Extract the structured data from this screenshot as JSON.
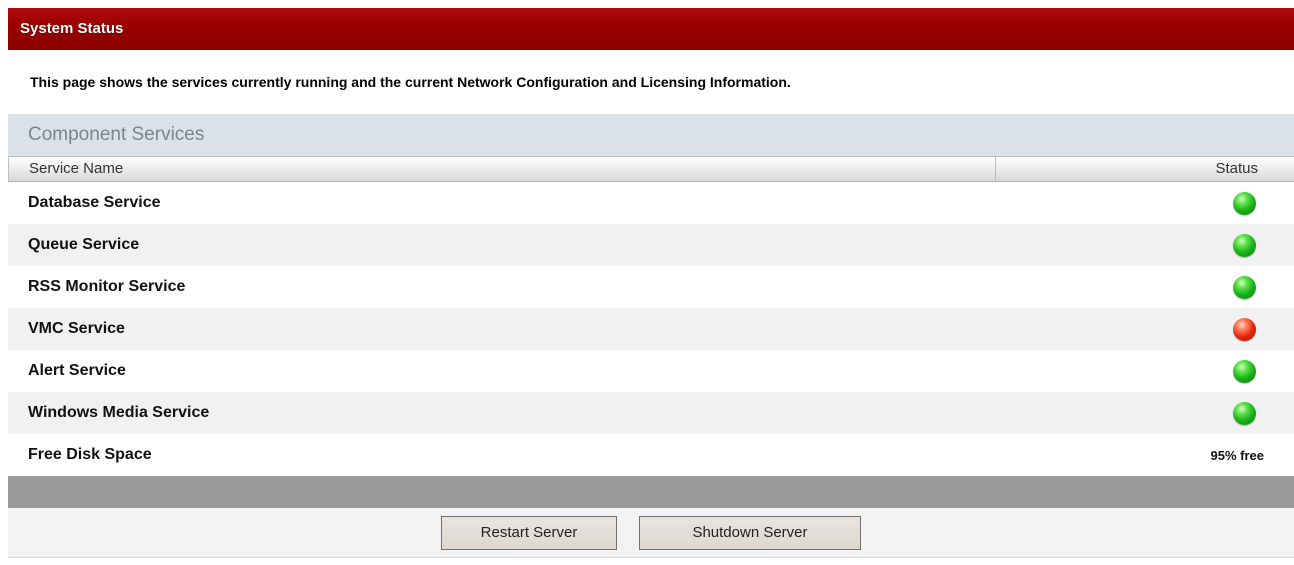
{
  "window": {
    "title": "System Status"
  },
  "description": "This page shows the services currently running and the current Network Configuration and Licensing Information.",
  "section": {
    "title": "Component Services"
  },
  "table": {
    "columns": {
      "name": "Service Name",
      "status": "Status"
    },
    "rows": [
      {
        "name": "Database Service",
        "status": "running",
        "status_icon": "green-status-icon"
      },
      {
        "name": "Queue Service",
        "status": "running",
        "status_icon": "green-status-icon"
      },
      {
        "name": "RSS Monitor Service",
        "status": "running",
        "status_icon": "green-status-icon"
      },
      {
        "name": "VMC Service",
        "status": "stopped",
        "status_icon": "red-status-icon"
      },
      {
        "name": "Alert Service",
        "status": "running",
        "status_icon": "green-status-icon"
      },
      {
        "name": "Windows Media Service",
        "status": "running",
        "status_icon": "green-status-icon"
      }
    ],
    "disk": {
      "name": "Free Disk Space",
      "value": "95% free"
    }
  },
  "buttons": {
    "restart": "Restart Server",
    "shutdown": "Shutdown Server"
  },
  "colors": {
    "title_bar": "#980000",
    "section_header_bg": "#dbe1e8",
    "status_ok": "#19b21a",
    "status_error": "#e22a10",
    "footer_bar": "#9a9a9a"
  }
}
